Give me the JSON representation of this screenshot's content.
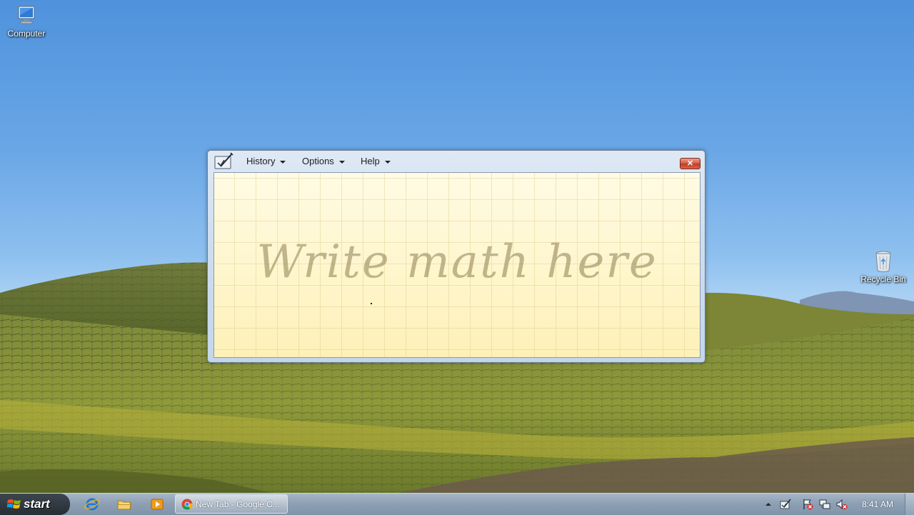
{
  "desktop": {
    "icons": [
      {
        "label": "Computer",
        "icon": "computer-icon"
      },
      {
        "label": "Recycle Bin",
        "icon": "recycle-bin-icon"
      }
    ]
  },
  "math_input_panel": {
    "app_icon": "math-input-panel-icon",
    "menus": [
      {
        "label": "History"
      },
      {
        "label": "Options"
      },
      {
        "label": "Help"
      }
    ],
    "close_label": "✕",
    "canvas_hint": "Write math here"
  },
  "taskbar": {
    "start_label": "start",
    "quick_launch": [
      "internet-explorer-icon",
      "folder-icon",
      "media-player-icon"
    ],
    "tasks": [
      {
        "label": "New Tab - Google C...",
        "icon": "chrome-icon"
      }
    ],
    "tray": {
      "icons": [
        "show-hidden-icons-chevron",
        "math-input-tray-icon",
        "action-center-icon",
        "network-icon",
        "volume-muted-icon"
      ],
      "time": "8:41 AM"
    }
  },
  "colors": {
    "sky": "#69a6e6",
    "canvas": "#fdf3c0",
    "close_button": "#c23b22",
    "taskbar": "#8ea0b4"
  }
}
